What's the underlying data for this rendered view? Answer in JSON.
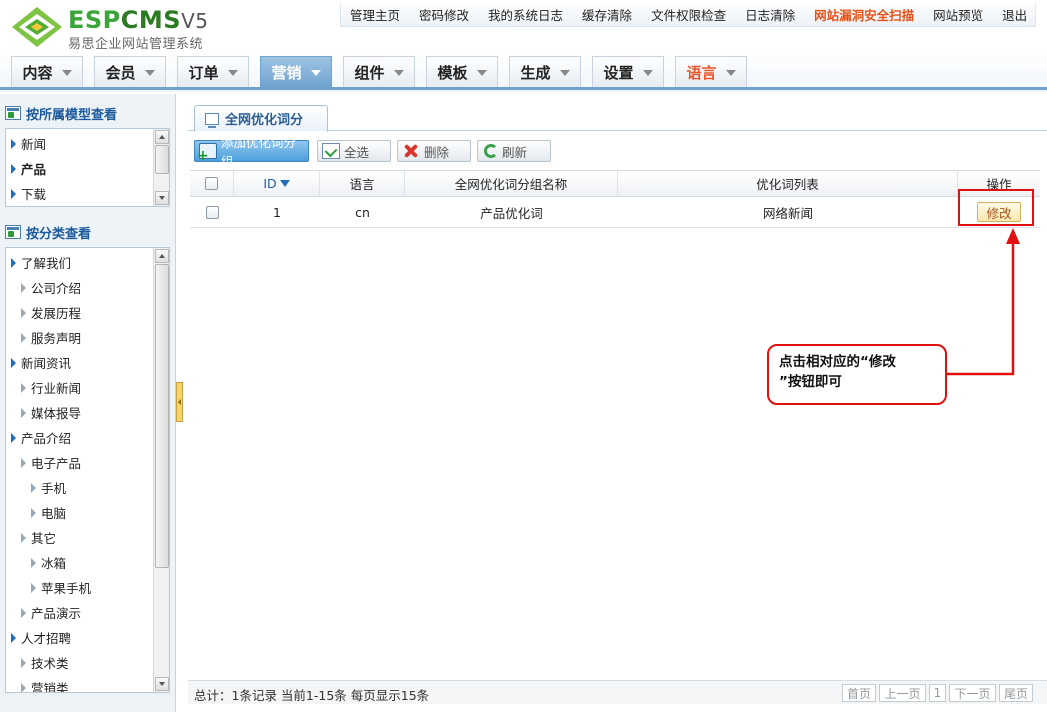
{
  "logo": {
    "word_a": "ESP",
    "word_b": "CMS",
    "word_c": "V5",
    "subtitle": "易思企业网站管理系统"
  },
  "toplinks": [
    {
      "label": "管理主页",
      "alert": false
    },
    {
      "label": "密码修改",
      "alert": false
    },
    {
      "label": "我的系统日志",
      "alert": false
    },
    {
      "label": "缓存清除",
      "alert": false
    },
    {
      "label": "文件权限检查",
      "alert": false
    },
    {
      "label": "日志清除",
      "alert": false
    },
    {
      "label": "网站漏洞安全扫描",
      "alert": true
    },
    {
      "label": "网站预览",
      "alert": false
    },
    {
      "label": "退出",
      "alert": false
    }
  ],
  "nav": [
    {
      "label": "内容"
    },
    {
      "label": "会员"
    },
    {
      "label": "订单"
    },
    {
      "label": "营销",
      "active": true
    },
    {
      "label": "组件"
    },
    {
      "label": "模板"
    },
    {
      "label": "生成"
    },
    {
      "label": "设置"
    },
    {
      "label": "语言",
      "lang": true
    }
  ],
  "sidebar": {
    "model_title": "按所属模型查看",
    "model_items": [
      {
        "label": "新闻",
        "bold": false
      },
      {
        "label": "产品",
        "bold": true
      },
      {
        "label": "下载",
        "bold": false
      }
    ],
    "category_title": "按分类查看",
    "category_items": [
      {
        "label": "了解我们",
        "level": 0
      },
      {
        "label": "公司介绍",
        "level": 1
      },
      {
        "label": "发展历程",
        "level": 1
      },
      {
        "label": "服务声明",
        "level": 1
      },
      {
        "label": "新闻资讯",
        "level": 0
      },
      {
        "label": "行业新闻",
        "level": 1
      },
      {
        "label": "媒体报导",
        "level": 1
      },
      {
        "label": "产品介绍",
        "level": 0
      },
      {
        "label": "电子产品",
        "level": 1
      },
      {
        "label": "手机",
        "level": 2
      },
      {
        "label": "电脑",
        "level": 2
      },
      {
        "label": "其它",
        "level": 1
      },
      {
        "label": "冰箱",
        "level": 2
      },
      {
        "label": "苹果手机",
        "level": 2
      },
      {
        "label": "产品演示",
        "level": 1
      },
      {
        "label": "人才招聘",
        "level": 0
      },
      {
        "label": "技术类",
        "level": 1
      },
      {
        "label": "营销类",
        "level": 1
      }
    ]
  },
  "main": {
    "tab_label": "全网优化词分",
    "toolbar": {
      "add": "添加优化词分组",
      "select_all": "全选",
      "delete": "删除",
      "refresh": "刷新"
    },
    "columns": {
      "id": "ID",
      "lang": "语言",
      "group_name": "全网优化词分组名称",
      "word_list": "优化词列表",
      "action": "操作"
    },
    "rows": [
      {
        "id": "1",
        "lang": "cn",
        "group_name": "产品优化词",
        "word_list": "网络新闻",
        "action": "修改"
      }
    ],
    "footer": {
      "info": "总计：1条记录 当前1-15条 每页显示15条",
      "first": "首页",
      "prev": "上一页",
      "page": "1",
      "next": "下一页",
      "last": "尾页"
    }
  },
  "annotation": {
    "line1": "点击相对应的“修改",
    "line2": "”按钮即可"
  },
  "colors": {
    "accent": "#6fa3cf",
    "alert": "#e5531b",
    "annotation": "#e01010"
  }
}
